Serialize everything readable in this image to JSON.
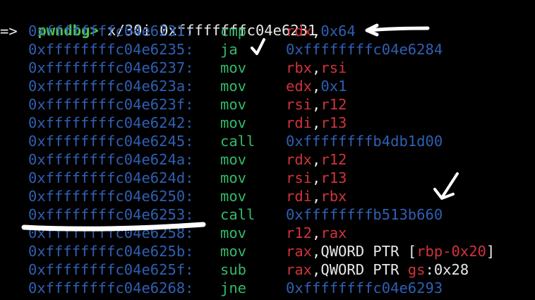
{
  "prompt": {
    "label": "pwndbg>",
    "command": " x/30i 0xffffffffc04e6231"
  },
  "current_marker": "=>",
  "instructions": [
    {
      "addr": "0xffffffffc04e6231:",
      "mnem": "cmp",
      "ops": [
        {
          "t": "rdx",
          "c": "reg"
        },
        {
          "t": ",",
          "c": "plain"
        },
        {
          "t": "0x64",
          "c": "imm"
        }
      ]
    },
    {
      "addr": "0xffffffffc04e6235:",
      "mnem": "ja",
      "ops": [
        {
          "t": "0xffffffffc04e6284",
          "c": "imm"
        }
      ]
    },
    {
      "addr": "0xffffffffc04e6237:",
      "mnem": "mov",
      "ops": [
        {
          "t": "rbx",
          "c": "reg"
        },
        {
          "t": ",",
          "c": "plain"
        },
        {
          "t": "rsi",
          "c": "reg"
        }
      ]
    },
    {
      "addr": "0xffffffffc04e623a:",
      "mnem": "mov",
      "ops": [
        {
          "t": "edx",
          "c": "reg"
        },
        {
          "t": ",",
          "c": "plain"
        },
        {
          "t": "0x1",
          "c": "imm"
        }
      ]
    },
    {
      "addr": "0xffffffffc04e623f:",
      "mnem": "mov",
      "ops": [
        {
          "t": "rsi",
          "c": "reg"
        },
        {
          "t": ",",
          "c": "plain"
        },
        {
          "t": "r12",
          "c": "reg"
        }
      ]
    },
    {
      "addr": "0xffffffffc04e6242:",
      "mnem": "mov",
      "ops": [
        {
          "t": "rdi",
          "c": "reg"
        },
        {
          "t": ",",
          "c": "plain"
        },
        {
          "t": "r13",
          "c": "reg"
        }
      ]
    },
    {
      "addr": "0xffffffffc04e6245:",
      "mnem": "call",
      "ops": [
        {
          "t": "0xffffffffb4db1d00",
          "c": "imm"
        }
      ]
    },
    {
      "addr": "0xffffffffc04e624a:",
      "mnem": "mov",
      "ops": [
        {
          "t": "rdx",
          "c": "reg"
        },
        {
          "t": ",",
          "c": "plain"
        },
        {
          "t": "r12",
          "c": "reg"
        }
      ]
    },
    {
      "addr": "0xffffffffc04e624d:",
      "mnem": "mov",
      "ops": [
        {
          "t": "rsi",
          "c": "reg"
        },
        {
          "t": ",",
          "c": "plain"
        },
        {
          "t": "r13",
          "c": "reg"
        }
      ]
    },
    {
      "addr": "0xffffffffc04e6250:",
      "mnem": "mov",
      "ops": [
        {
          "t": "rdi",
          "c": "reg"
        },
        {
          "t": ",",
          "c": "plain"
        },
        {
          "t": "rbx",
          "c": "reg"
        }
      ]
    },
    {
      "addr": "0xffffffffc04e6253:",
      "mnem": "call",
      "ops": [
        {
          "t": "0xffffffffb513b660",
          "c": "imm"
        }
      ]
    },
    {
      "addr": "0xffffffffc04e6258:",
      "mnem": "mov",
      "ops": [
        {
          "t": "r12",
          "c": "reg"
        },
        {
          "t": ",",
          "c": "plain"
        },
        {
          "t": "rax",
          "c": "reg"
        }
      ]
    },
    {
      "addr": "0xffffffffc04e625b:",
      "mnem": "mov",
      "ops": [
        {
          "t": "rax",
          "c": "reg"
        },
        {
          "t": ",QWORD PTR [",
          "c": "plain"
        },
        {
          "t": "rbp-0x20",
          "c": "reg"
        },
        {
          "t": "]",
          "c": "plain"
        }
      ]
    },
    {
      "addr": "0xffffffffc04e625f:",
      "mnem": "sub",
      "ops": [
        {
          "t": "rax",
          "c": "reg"
        },
        {
          "t": ",QWORD PTR ",
          "c": "plain"
        },
        {
          "t": "gs",
          "c": "reg"
        },
        {
          "t": ":0x28",
          "c": "plain"
        }
      ]
    },
    {
      "addr": "0xffffffffc04e6268:",
      "mnem": "jne",
      "ops": [
        {
          "t": "0xffffffffc04e6293",
          "c": "imm"
        }
      ]
    }
  ],
  "colors": {
    "background": "#000000",
    "prompt": "#4ec94e",
    "address": "#2f5fb3",
    "mnemonic": "#35b86a",
    "register": "#d0333c",
    "immediate": "#2f5fb3",
    "text": "#e8e8e8",
    "annotation": "#ffffff"
  }
}
